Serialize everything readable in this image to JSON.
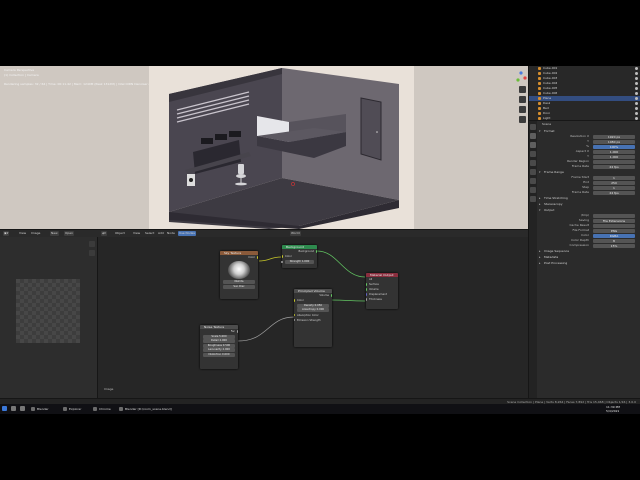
{
  "viewport": {
    "info_lines": [
      "Camera Perspective",
      "(1) Collection | Camera",
      "Rendering samples: 32 / 64 | Time: 00:11.42 | Mem: 1240M (Peak 1312M) | Intel OIDN Denoiser enabled"
    ],
    "overlay_text": "Saved \"room_scene.blend\""
  },
  "outliner": {
    "rows": [
      {
        "label": "Cube.001"
      },
      {
        "label": "Cube.002"
      },
      {
        "label": "Cube.003"
      },
      {
        "label": "Cube.004"
      },
      {
        "label": "Cube.005"
      },
      {
        "label": "Cube.006"
      },
      {
        "label": "Plane",
        "selected": true
      },
      {
        "label": "Desk"
      },
      {
        "label": "Bed"
      },
      {
        "label": "Door"
      },
      {
        "label": "Light"
      }
    ]
  },
  "properties": {
    "object_name": "Scene",
    "sections": [
      {
        "label": "Format",
        "open": true
      },
      {
        "label": "Resolution X",
        "value": "1920 px",
        "row": true
      },
      {
        "label": "Y",
        "value": "1080 px",
        "row": true
      },
      {
        "label": "%",
        "value": "100%",
        "row": true,
        "blue": true
      },
      {
        "label": "Aspect X",
        "value": "1.000",
        "row": true
      },
      {
        "label": "Y",
        "value": "1.000",
        "row": true
      },
      {
        "label": "Render Region",
        "value": "",
        "row": true
      },
      {
        "label": "Frame Rate",
        "value": "24 fps",
        "row": true
      },
      {
        "label": "Frame Range",
        "open": true
      },
      {
        "label": "Frame Start",
        "value": "1",
        "row": true
      },
      {
        "label": "End",
        "value": "250",
        "row": true
      },
      {
        "label": "Step",
        "value": "1",
        "row": true
      },
      {
        "label": "Frame Rate",
        "value": "24 fps",
        "row": true
      },
      {
        "label": "Time Stretching",
        "open": false
      },
      {
        "label": "Stereoscopy",
        "open": false
      },
      {
        "label": "Output",
        "open": true
      },
      {
        "label": "/tmp\\",
        "value": "",
        "row": true
      },
      {
        "label": "Saving",
        "value": "File Extensions",
        "row": true
      },
      {
        "label": "Cache Result",
        "value": "",
        "row": true
      },
      {
        "label": "File Format",
        "value": "PNG",
        "row": true
      },
      {
        "label": "Color",
        "value": "RGBA",
        "row": true,
        "blue": true
      },
      {
        "label": "Color Depth",
        "value": "8",
        "row": true
      },
      {
        "label": "Compression",
        "value": "15%",
        "row": true
      },
      {
        "label": "Image Sequence",
        "open": false
      },
      {
        "label": "Metadata",
        "open": false
      },
      {
        "label": "Post Processing",
        "open": false
      }
    ]
  },
  "editor_header": {
    "left": [
      "View",
      "Image",
      "New",
      "Open"
    ],
    "right": [
      "Object",
      "View",
      "Select",
      "Add",
      "Node",
      "Use Nodes"
    ],
    "slot": "Slot 1",
    "material": "Material"
  },
  "nodes": {
    "image_texture": {
      "title": "Sky Texture",
      "rows": [
        "Color"
      ],
      "fields": [
        "Nishita",
        "Sun Disc"
      ]
    },
    "background": {
      "title": "Background",
      "rows": [
        "Background",
        "Color",
        "Strength"
      ],
      "strength": "1.000"
    },
    "world_output": {
      "title": "World Output",
      "rows": [
        "All",
        "Surface",
        "Volume"
      ]
    },
    "principled": {
      "title": "Principled Volume",
      "rows": [
        "BSDF",
        "Volume",
        "Color",
        "Density",
        "Anisotropy",
        "Absorption Color",
        "Emission Strength"
      ],
      "fields": [
        "Density 0.050",
        "Anisotropy 0.000"
      ]
    },
    "material_output": {
      "title": "Material Output",
      "rows": [
        "All",
        "Surface",
        "Volume",
        "Displacement",
        "Thickness"
      ]
    },
    "noise": {
      "title": "Noise Texture",
      "rows": [
        "Fac",
        "Color",
        "Vector"
      ],
      "fields": [
        "Scale 5.000",
        "Detail 2.000",
        "Roughness 0.500",
        "Lacunarity 2.000",
        "Distortion 0.000"
      ]
    }
  },
  "image_editor_label": "Image",
  "node_editor_label": "World",
  "status_bar": {
    "right": "Scene Collection | Plane | Verts 8,264 | Faces 7,892 | Tris 15,468 | Objects 1/16 | 3.0.0"
  },
  "taskbar": {
    "apps": [
      "Blender",
      "Explorer",
      "Chrome",
      "Photos",
      "Blender [D:\\room_scene.blend]"
    ],
    "time": "11:39 PM",
    "date": "5/4/2022"
  }
}
